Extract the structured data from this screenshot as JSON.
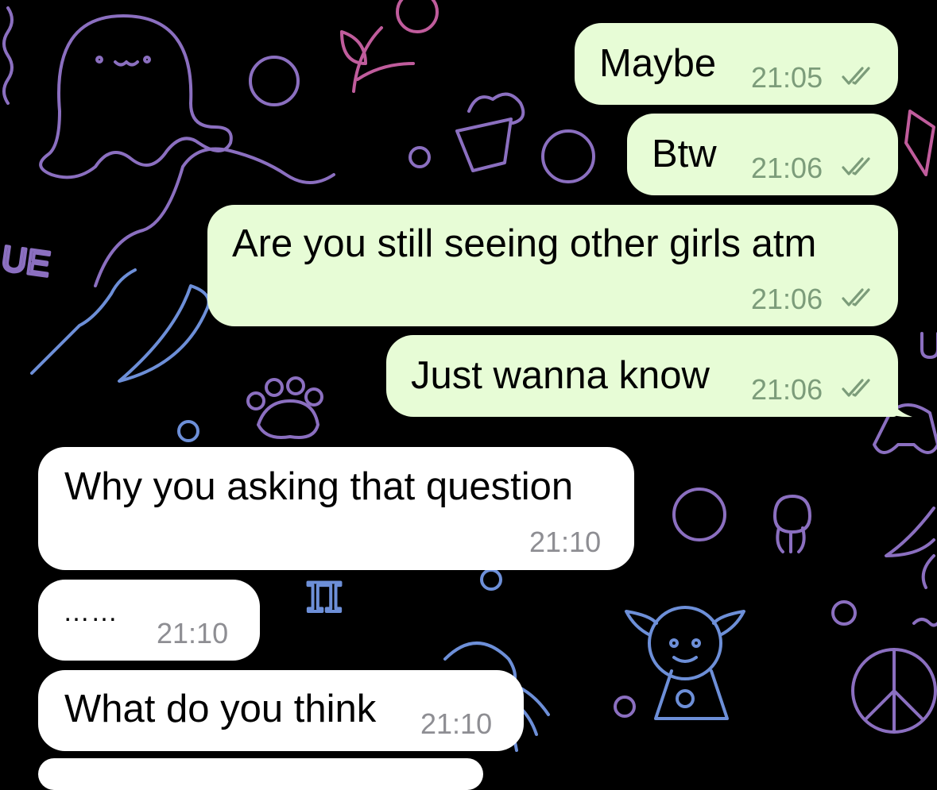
{
  "wallpaper": {
    "text_fragment": "UE",
    "colors": {
      "purple": "#8b6fc0",
      "blue": "#6d8fd8",
      "pink": "#c05c9c"
    }
  },
  "messages": [
    {
      "direction": "outgoing",
      "text": "Maybe",
      "time": "21:05",
      "status": "read-double-check"
    },
    {
      "direction": "outgoing",
      "text": "Btw",
      "time": "21:06",
      "status": "read-double-check"
    },
    {
      "direction": "outgoing",
      "text": "Are you still seeing other girls atm",
      "time": "21:06",
      "status": "read-double-check"
    },
    {
      "direction": "outgoing",
      "text": "Just wanna know",
      "time": "21:06",
      "status": "read-double-check"
    },
    {
      "direction": "incoming",
      "text": "Why you asking that question",
      "time": "21:10"
    },
    {
      "direction": "incoming",
      "text": "……",
      "time": "21:10"
    },
    {
      "direction": "incoming",
      "text": "What do you think",
      "time": "21:10"
    }
  ],
  "theme": {
    "outgoing_bubble": "#e7fcd6",
    "incoming_bubble": "#ffffff",
    "background": "#000000"
  }
}
